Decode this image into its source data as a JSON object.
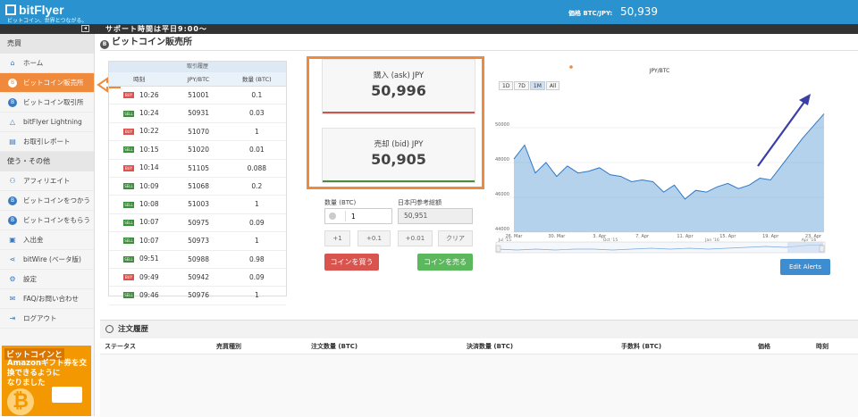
{
  "header": {
    "logo": "bitFlyer",
    "tagline": "ビットコイン、世界とつながる。",
    "price_label": "価格 BTC/JPY:",
    "price_value": "50,939"
  },
  "support_bar": {
    "text": "サポート時間は平日9:00～"
  },
  "sidebar": {
    "section1": "売買",
    "items1": [
      {
        "label": "ホーム",
        "icon": "home-icon"
      },
      {
        "label": "ビットコイン販売所",
        "icon": "bitcoin-icon",
        "active": true
      },
      {
        "label": "ビットコイン取引所",
        "icon": "bitcoin-icon"
      },
      {
        "label": "bitFlyer Lightning",
        "icon": "triangle-icon"
      },
      {
        "label": "お取引レポート",
        "icon": "report-icon"
      }
    ],
    "section2": "使う・その他",
    "items2": [
      {
        "label": "アフィリエイト",
        "icon": "users-icon"
      },
      {
        "label": "ビットコインをつかう",
        "icon": "bitcoin-icon"
      },
      {
        "label": "ビットコインをもらう",
        "icon": "bitcoin-icon"
      },
      {
        "label": "入出金",
        "icon": "wallet-icon"
      },
      {
        "label": "bitWire (ベータ版)",
        "icon": "share-icon"
      },
      {
        "label": "設定",
        "icon": "gear-icon"
      },
      {
        "label": "FAQ/お問い合わせ",
        "icon": "mail-icon"
      },
      {
        "label": "ログアウト",
        "icon": "logout-icon"
      }
    ],
    "banner": {
      "line1": "ビットコインと",
      "line2": "Amazonギフト券を交換できるように",
      "line3": "なりました"
    }
  },
  "page_title": "ビットコイン販売所",
  "trades": {
    "caption": "取引履歴",
    "headers": [
      "時刻",
      "JPY/BTC",
      "数量 (BTC)"
    ],
    "rows": [
      {
        "side": "BUY",
        "time": "10:26",
        "price": "51001",
        "qty": "0.1"
      },
      {
        "side": "SELL",
        "time": "10:24",
        "price": "50931",
        "qty": "0.03"
      },
      {
        "side": "BUY",
        "time": "10:22",
        "price": "51070",
        "qty": "1"
      },
      {
        "side": "SELL",
        "time": "10:15",
        "price": "51020",
        "qty": "0.01"
      },
      {
        "side": "BUY",
        "time": "10:14",
        "price": "51105",
        "qty": "0.088"
      },
      {
        "side": "SELL",
        "time": "10:09",
        "price": "51068",
        "qty": "0.2"
      },
      {
        "side": "SELL",
        "time": "10:08",
        "price": "51003",
        "qty": "1"
      },
      {
        "side": "SELL",
        "time": "10:07",
        "price": "50975",
        "qty": "0.09"
      },
      {
        "side": "SELL",
        "time": "10:07",
        "price": "50973",
        "qty": "1"
      },
      {
        "side": "SELL",
        "time": "09:51",
        "price": "50988",
        "qty": "0.98"
      },
      {
        "side": "BUY",
        "time": "09:49",
        "price": "50942",
        "qty": "0.09"
      },
      {
        "side": "SELL",
        "time": "09:46",
        "price": "50976",
        "qty": "1"
      }
    ]
  },
  "prices": {
    "ask_label": "購入 (ask) JPY",
    "ask_value": "50,996",
    "bid_label": "売却 (bid) JPY",
    "bid_value": "50,905"
  },
  "order_form": {
    "qty_label": "数量 (BTC)",
    "qty_value": "1",
    "ref_label": "日本円参考総額",
    "ref_value": "50,951",
    "steps": [
      "+1",
      "+0.1",
      "+0.01",
      "クリア"
    ],
    "buy_label": "コインを買う",
    "sell_label": "コインを売る"
  },
  "chart_controls": {
    "zoom": [
      "1D",
      "7D",
      "1M",
      "All"
    ],
    "selected": "1M",
    "edit_alerts": "Edit Alerts"
  },
  "chart_data": {
    "type": "area",
    "title": "JPY/BTC",
    "x": [
      "26. Mar",
      "27. Mar",
      "28. Mar",
      "29. Mar",
      "30. Mar",
      "31. Mar",
      "1. Apr",
      "2. Apr",
      "3. Apr",
      "4. Apr",
      "5. Apr",
      "6. Apr",
      "7. Apr",
      "8. Apr",
      "9. Apr",
      "10. Apr",
      "11. Apr",
      "12. Apr",
      "13. Apr",
      "14. Apr",
      "15. Apr",
      "16. Apr",
      "17. Apr",
      "18. Apr",
      "19. Apr",
      "20. Apr",
      "21. Apr",
      "22. Apr",
      "23. Apr",
      "24. Apr"
    ],
    "y": [
      48200,
      49000,
      47400,
      48000,
      47200,
      47800,
      47400,
      47500,
      47700,
      47300,
      47200,
      46900,
      47000,
      46900,
      46300,
      46700,
      45900,
      46400,
      46300,
      46600,
      46800,
      46500,
      46700,
      47100,
      47000,
      47800,
      48600,
      49400,
      50100,
      50800
    ],
    "ylim": [
      44000,
      52000
    ],
    "yticks": [
      "44000",
      "46000",
      "48000",
      "50000"
    ],
    "xticks": [
      "26. Mar",
      "30. Mar",
      "3. Apr",
      "7. Apr",
      "11. Apr",
      "15. Apr",
      "19. Apr",
      "23. Apr"
    ],
    "navigator_labels": [
      "Jul '15",
      "Oct '15",
      "Jan '16",
      "Apr '16"
    ],
    "color": "#5b9bd5"
  },
  "order_history": {
    "title": "注文履歴",
    "columns": [
      "ステータス",
      "売買種別",
      "注文数量 (BTC)",
      "決済数量 (BTC)",
      "手数料 (BTC)",
      "価格",
      "時刻"
    ]
  }
}
